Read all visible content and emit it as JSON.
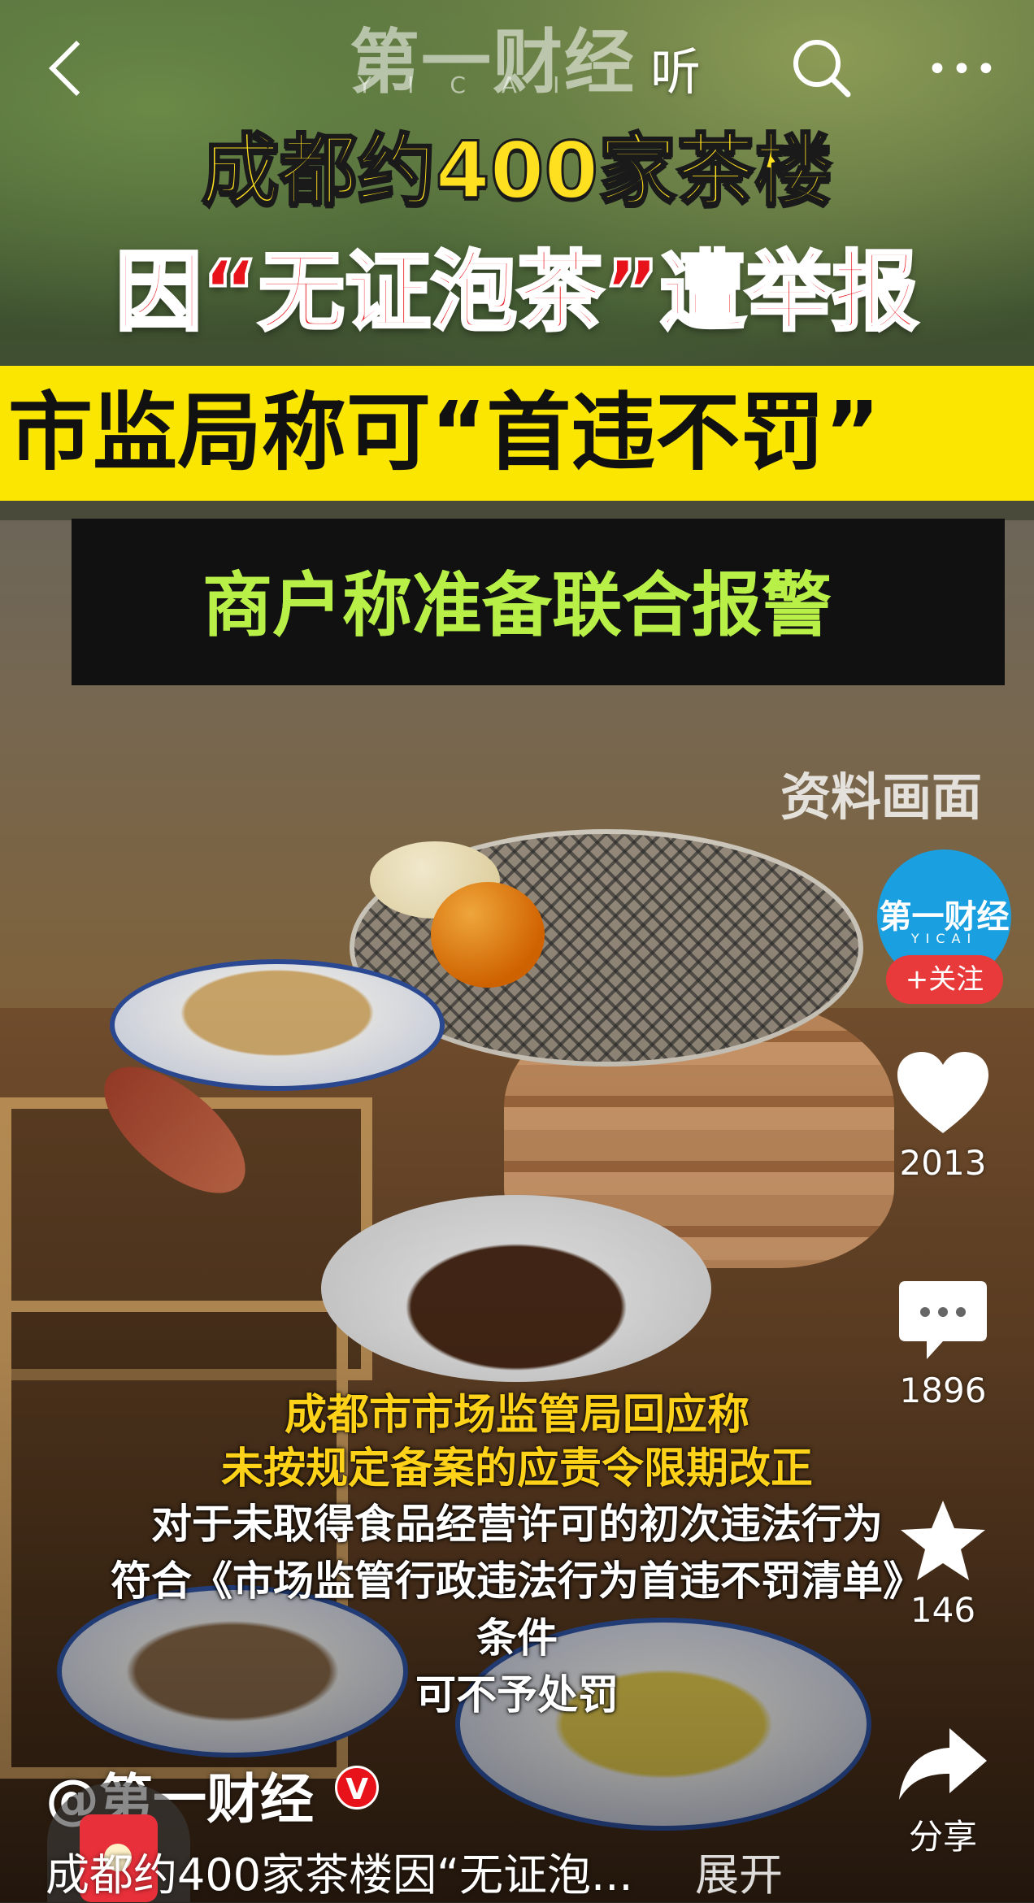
{
  "top_bar": {
    "listen_label": "听",
    "watermark": "第一财经",
    "watermark_sub": "YICAI"
  },
  "headlines": {
    "line1": "成都约400家茶楼",
    "line2": "因“无证泡茶”遭举报",
    "line3": "市监局称可“首违不罚”",
    "line4": "商户称准备联合报警"
  },
  "reference_tag": "资料画面",
  "subtitles": {
    "yellow": [
      "成都市市场监管局回应称",
      "未按规定备案的应责令限期改正"
    ],
    "white": [
      "对于未取得食品经营许可的初次违法行为",
      "符合《市场监管行政违法行为首违不罚清单》",
      "条件",
      "可不予处罚"
    ]
  },
  "side_actions": {
    "avatar_text": "第一财经",
    "avatar_sub": "YICAI",
    "follow_label": "+关注",
    "like_count": "2013",
    "comment_count": "1896",
    "favorite_count": "146",
    "share_label": "分享"
  },
  "post": {
    "author": "@第一财经",
    "verified_badge": "V",
    "caption": "成都约400家茶楼因“无证泡...",
    "expand_label": "展开"
  },
  "colors": {
    "headline_yellow": "#ffe020",
    "headline_red": "#e8121a",
    "band_yellow": "#fae600",
    "follow_red": "#e83a3a",
    "avatar_blue": "#1aa0e0"
  }
}
